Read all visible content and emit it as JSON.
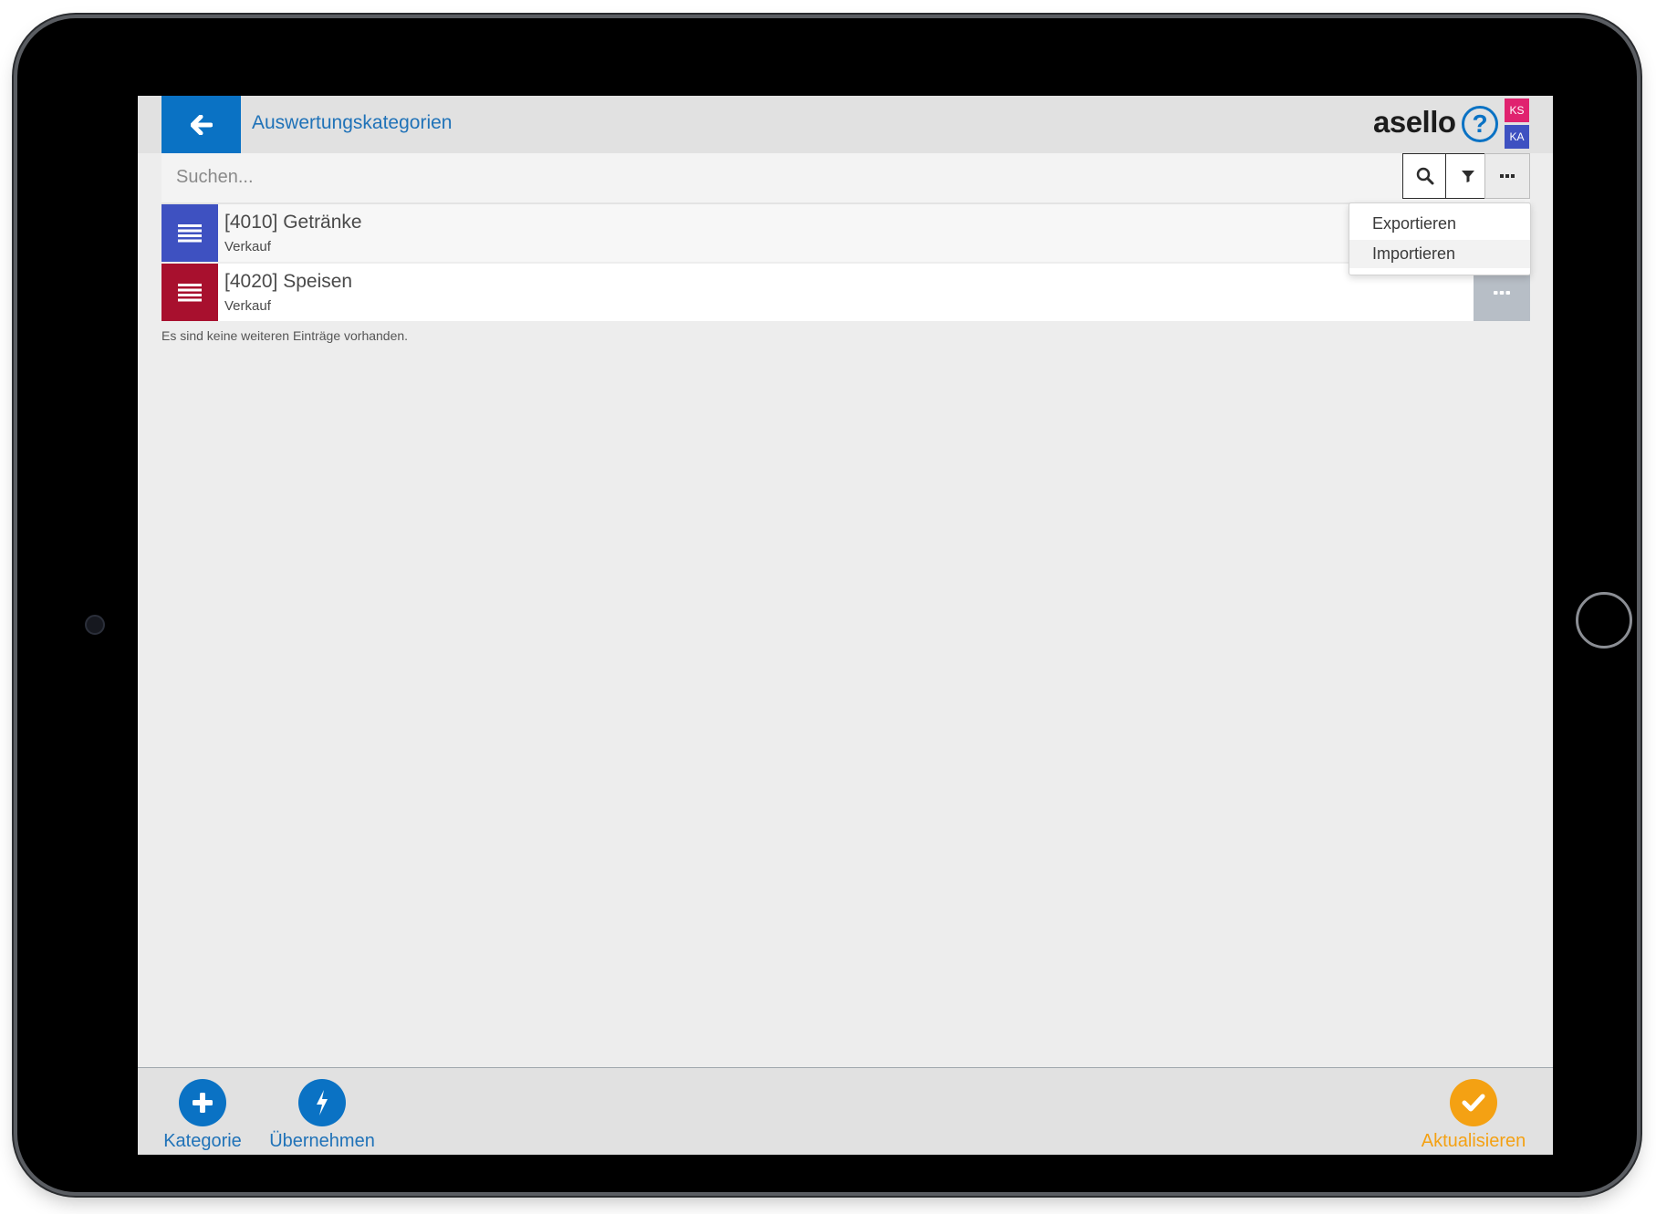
{
  "header": {
    "title": "Auswertungskategorien",
    "logo": "asello",
    "help": "?",
    "badges": [
      {
        "label": "KS",
        "color": "#e0226f"
      },
      {
        "label": "KA",
        "color": "#3e51c1"
      }
    ],
    "accent_color": "#0a72c4"
  },
  "search": {
    "placeholder": "Suchen...",
    "value": "",
    "icons": [
      "search-icon",
      "filter-icon",
      "more-icon"
    ]
  },
  "dropdown": {
    "items": [
      {
        "label": "Exportieren"
      },
      {
        "label": "Importieren"
      }
    ]
  },
  "list": {
    "items": [
      {
        "title": "[4010] Getränke",
        "subtitle": "Verkauf",
        "color": "#3e51c1",
        "icon": "list-icon"
      },
      {
        "title": "[4020] Speisen",
        "subtitle": "Verkauf",
        "color": "#a8102e",
        "icon": "list-icon"
      }
    ],
    "empty_note": "Es sind keine weiteren Einträge vorhanden."
  },
  "footer": {
    "actions": [
      {
        "label": "Kategorie",
        "icon": "plus-icon",
        "color": "#0a72c4"
      },
      {
        "label": "Übernehmen",
        "icon": "lightning-icon",
        "color": "#0a72c4"
      },
      {
        "label": "Aktualisieren",
        "icon": "check-icon",
        "color": "#f4a113"
      }
    ]
  }
}
